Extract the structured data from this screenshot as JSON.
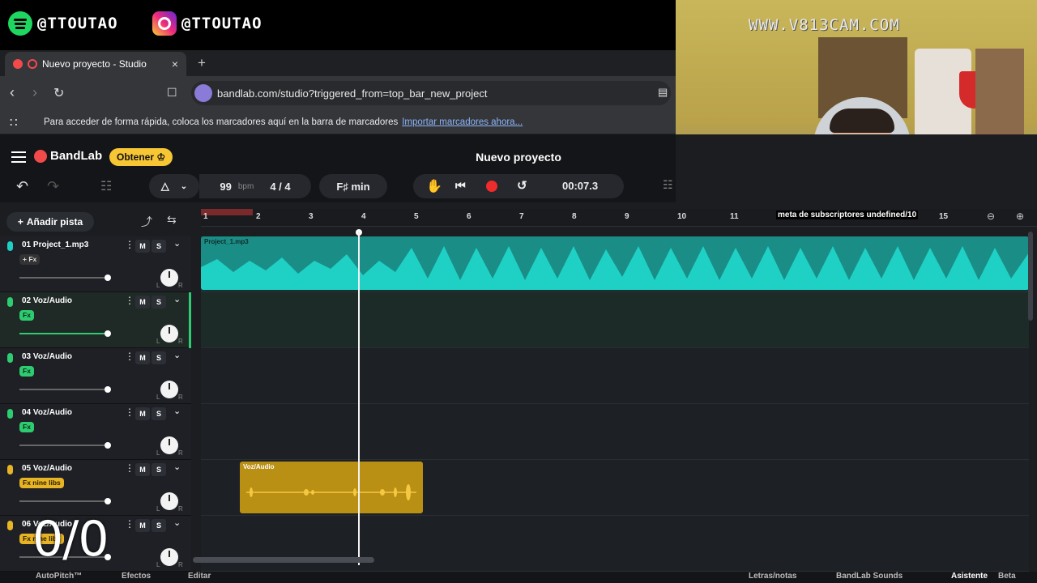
{
  "overlay": {
    "spotify_handle": "@TTOUTAO",
    "instagram_handle": "@TTOUTAO"
  },
  "browser": {
    "tab_title": "Nuevo proyecto - Studio",
    "tab_close": "×",
    "new_tab": "+",
    "url": "bandlab.com/studio?triggered_from=top_bar_new_project",
    "bookmarks_text": "Para acceder de forma rápida, coloca los marcadores aquí en la barra de marcadores",
    "bookmarks_link": "Importar marcadores ahora..."
  },
  "webcam": {
    "watermark": "WWW.V813CAM.COM"
  },
  "studio": {
    "logo": "BandLab",
    "obtener": "Obtener",
    "project_title": "Nuevo proyecto",
    "bpm_value": "99",
    "bpm_unit": "bpm",
    "time_signature": "4 / 4",
    "key": "F♯ min",
    "time_display": "00:07.3",
    "add_track": "Añadir pista",
    "ruler_ticks": [
      "1",
      "2",
      "3",
      "4",
      "5",
      "6",
      "7",
      "8",
      "9",
      "10",
      "11",
      "15"
    ],
    "ruler_overlay": "meta de subscriptores undefined/10",
    "tracks": [
      {
        "name": "01  Project_1.mp3",
        "fx": "+ Fx",
        "color": "#1ecfc4",
        "fx_style": "plain"
      },
      {
        "name": "02  Voz/Audio",
        "fx": "Fx",
        "color": "#2ecc71",
        "fx_style": "green"
      },
      {
        "name": "03  Voz/Audio",
        "fx": "Fx",
        "color": "#2ecc71",
        "fx_style": "green"
      },
      {
        "name": "04  Voz/Audio",
        "fx": "Fx",
        "color": "#2ecc71",
        "fx_style": "green"
      },
      {
        "name": "05  Voz/Audio",
        "fx": "Fx nine libs",
        "color": "#e7b426",
        "fx_style": "yellow"
      },
      {
        "name": "06  Voz/Audio",
        "fx": "Fx nine libs",
        "color": "#e7b426",
        "fx_style": "yellow"
      }
    ],
    "m_label": "M",
    "s_label": "S",
    "clips": {
      "clip1_label": "Project_1.mp3",
      "clip5_label": "Voz/Audio"
    },
    "bottom": {
      "autopitch": "AutoPitch™",
      "efectos": "Efectos",
      "editar": "Editar",
      "letras": "Letras/notas",
      "sounds": "BandLab Sounds",
      "asistente": "Asistente",
      "beta": "Beta"
    },
    "counter": "0/0"
  },
  "colors": {
    "teal": "#1ecfc4",
    "yellow": "#e7b426",
    "record": "#f02b2b",
    "obtener": "#f7c634"
  }
}
